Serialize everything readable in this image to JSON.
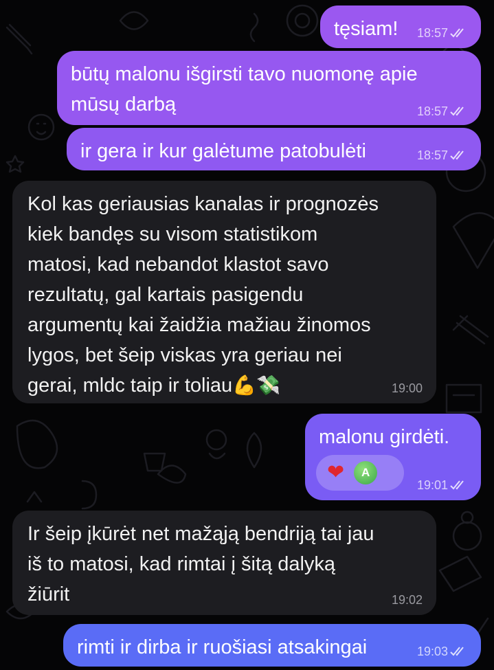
{
  "colors": {
    "background": "#050506",
    "outgoing_top": "#9a58f0",
    "outgoing_mid": "#7f5cf3",
    "outgoing_bottom": "#5a6cf6",
    "incoming": "#1d1d21"
  },
  "messages": [
    {
      "direction": "out",
      "text": "tęsiam!",
      "time": "18:57",
      "status": "read"
    },
    {
      "direction": "out",
      "text": "būtų malonu išgirsti tavo nuomonę apie\nmūsų darbą",
      "time": "18:57",
      "status": "read"
    },
    {
      "direction": "out",
      "text": "ir gera ir kur galėtume patobulėti",
      "time": "18:57",
      "status": "read"
    },
    {
      "direction": "in",
      "text": "Kol kas geriausias kanalas ir prognozės\nkiek bandęs su visom statistikom\nmatosi, kad nebandot klastot savo\nrezultatų, gal kartais pasigendu\nargumentų kai žaidžia mažiau žinomos\nlygos, bet šeip viskas yra geriau nei\ngerai, mldc taip ir toliau",
      "emojis": "💪💸",
      "time": "19:00"
    },
    {
      "direction": "out",
      "text": "malonu girdėti.",
      "time": "19:01",
      "status": "read",
      "reaction": {
        "emoji": "❤",
        "avatar_initial": "A"
      }
    },
    {
      "direction": "in",
      "text": "Ir šeip įkūrėt net mažąją bendriją tai jau\niš to matosi, kad rimtai į šitą dalyką\nžiūrit",
      "time": "19:02"
    },
    {
      "direction": "out",
      "text": "rimti ir dirba ir ruošiasi atsakingai",
      "time": "19:03",
      "status": "read"
    }
  ]
}
